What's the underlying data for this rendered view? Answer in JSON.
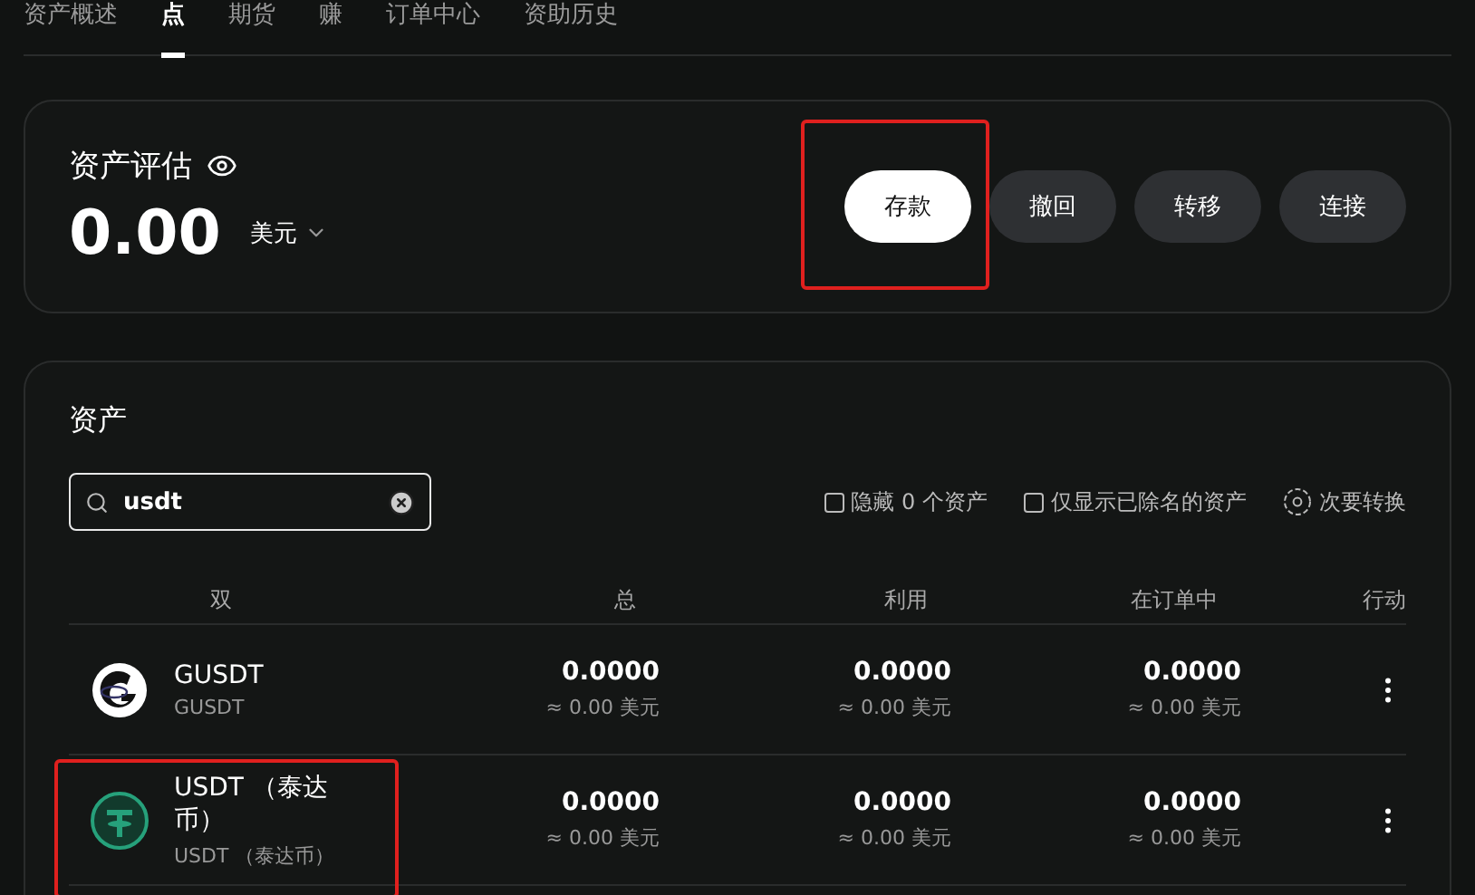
{
  "tabs": [
    {
      "label": "资产概述",
      "selected": false
    },
    {
      "label": "点",
      "selected": true
    },
    {
      "label": "期货",
      "selected": false
    },
    {
      "label": "赚",
      "selected": false
    },
    {
      "label": "订单中心",
      "selected": false
    },
    {
      "label": "资助历史",
      "selected": false
    }
  ],
  "valuation": {
    "title": "资产评估",
    "amount": "0.00",
    "currency": "美元"
  },
  "actions": [
    {
      "label": "存款",
      "primary": true,
      "highlighted": true
    },
    {
      "label": "撤回",
      "primary": false,
      "highlighted": false
    },
    {
      "label": "转移",
      "primary": false,
      "highlighted": false
    },
    {
      "label": "连接",
      "primary": false,
      "highlighted": false
    }
  ],
  "assets": {
    "title": "资产",
    "search": {
      "value": "usdt"
    },
    "filters": [
      {
        "label": "隐藏 0 个资产",
        "checked": false
      },
      {
        "label": "仅显示已除名的资产",
        "checked": false
      }
    ],
    "convert": "次要转换",
    "table": {
      "columns": [
        "双",
        "总",
        "利用",
        "在订单中",
        "行动"
      ],
      "rows": [
        {
          "kind": "gusdt",
          "name": "GUSDT",
          "subtitle": "GUSDT",
          "total": "0.0000",
          "total_fiat": "≈ 0.00 美元",
          "available": "0.0000",
          "available_fiat": "≈ 0.00 美元",
          "in_orders": "0.0000",
          "in_orders_fiat": "≈ 0.00 美元",
          "highlighted": false
        },
        {
          "kind": "tether",
          "name": "USDT （泰达币）",
          "subtitle": "USDT （泰达币）",
          "total": "0.0000",
          "total_fiat": "≈ 0.00 美元",
          "available": "0.0000",
          "available_fiat": "≈ 0.00 美元",
          "in_orders": "0.0000",
          "in_orders_fiat": "≈ 0.00 美元",
          "highlighted": true
        }
      ]
    }
  }
}
